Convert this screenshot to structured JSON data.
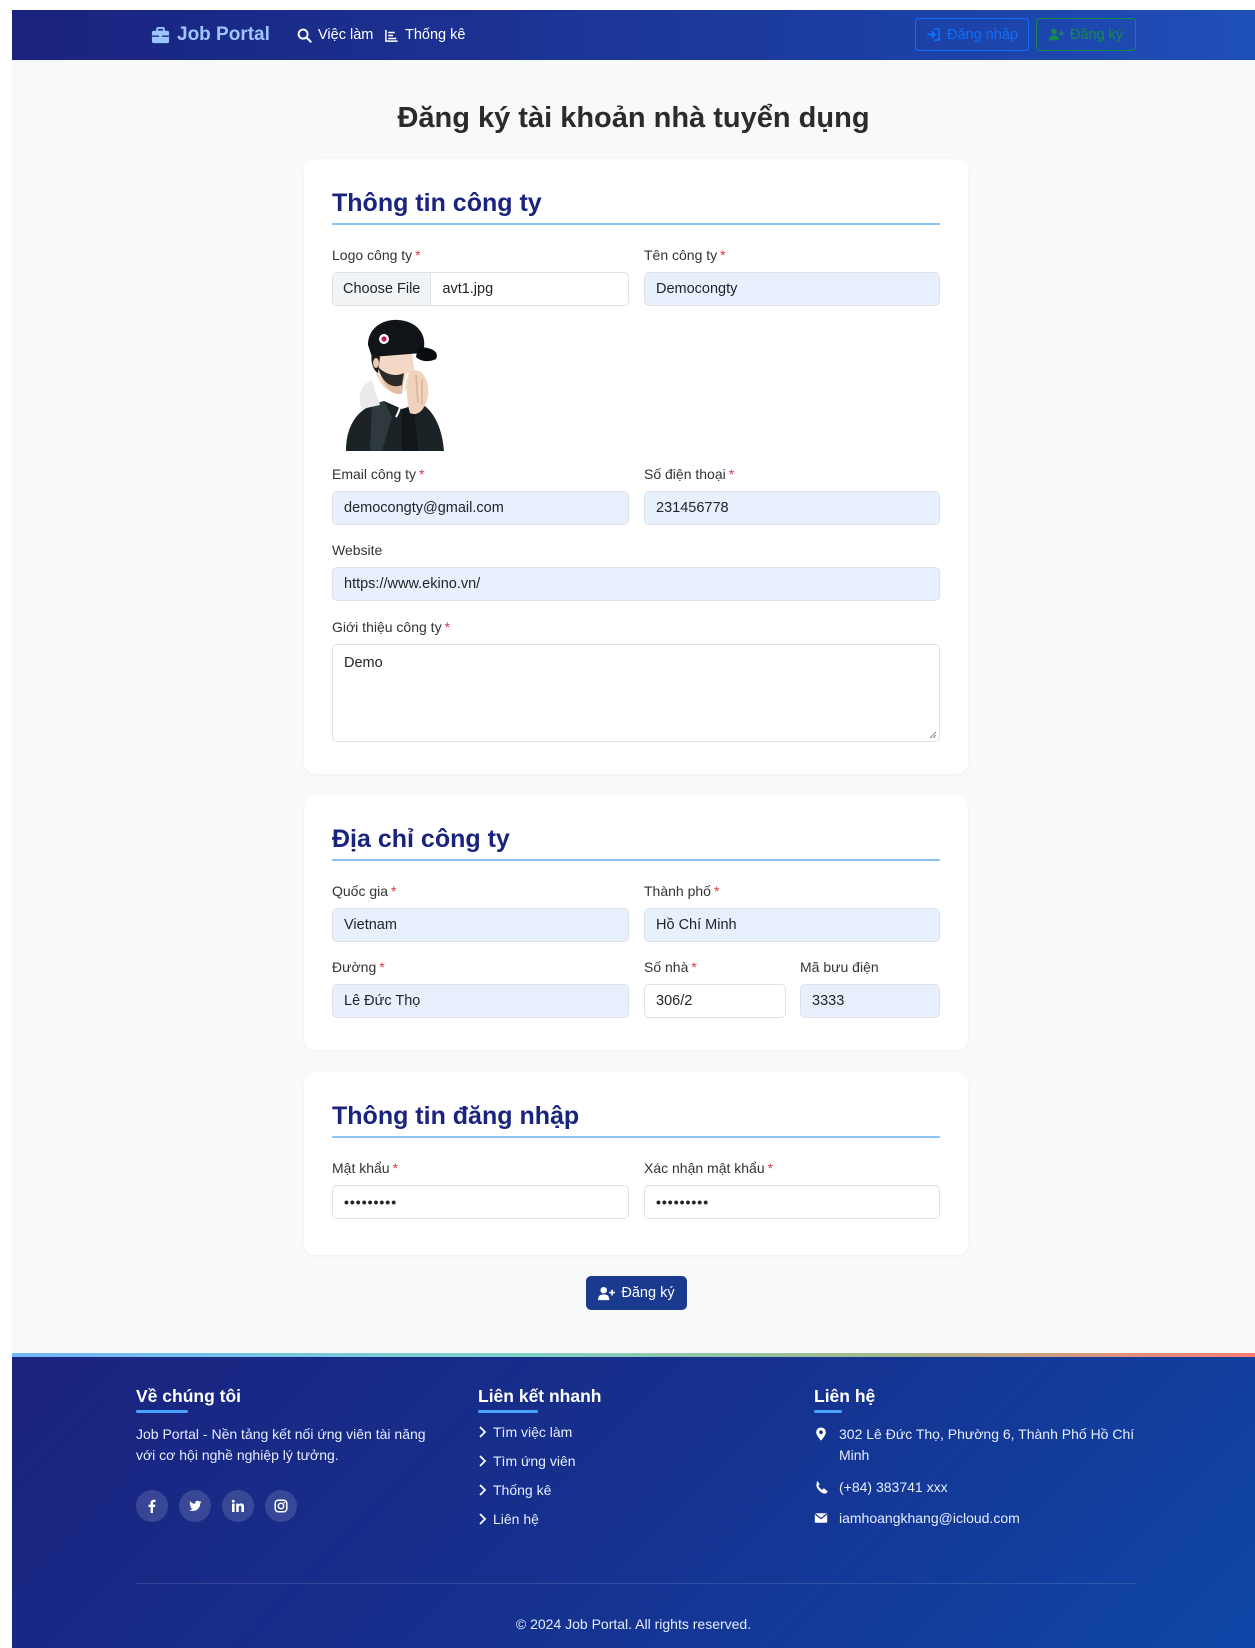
{
  "nav": {
    "brand": "Job Portal",
    "links": [
      {
        "label": "Việc làm"
      },
      {
        "label": "Thống kê"
      }
    ],
    "login": "Đăng nhập",
    "register": "Đăng ký"
  },
  "page": {
    "title": "Đăng ký tài khoản nhà tuyển dụng"
  },
  "company_info": {
    "title": "Thông tin công ty",
    "logo_label": "Logo công ty",
    "file_button": "Choose File",
    "file_name": "avt1.jpg",
    "name_label": "Tên công ty",
    "name_value": "Democongty",
    "email_label": "Email công ty",
    "email_value": "democongty@gmail.com",
    "phone_label": "Số điện thoại",
    "phone_value": "231456778",
    "website_label": "Website",
    "website_value": "https://www.ekino.vn/",
    "intro_label": "Giới thiệu công ty",
    "intro_value": "Demo"
  },
  "address": {
    "title": "Địa chỉ công ty",
    "country_label": "Quốc gia",
    "country_value": "Vietnam",
    "city_label": "Thành phố",
    "city_value": "Hồ Chí Minh",
    "street_label": "Đường",
    "street_value": "Lê Đức Thọ",
    "house_label": "Số nhà",
    "house_value": "306/2",
    "postal_label": "Mã bưu điện",
    "postal_value": "3333"
  },
  "login_info": {
    "title": "Thông tin đăng nhập",
    "password_label": "Mật khẩu",
    "password_value": "•••••••••",
    "confirm_label": "Xác nhận mật khẩu",
    "confirm_value": "•••••••••"
  },
  "required_mark": "*",
  "submit": "Đăng ký",
  "footer": {
    "about_title": "Về chúng tôi",
    "about_text_1": "Job Portal - Nền tảng kết nối ứng viên tài năng",
    "about_text_2": "với cơ hội nghề nghiệp lý tưởng.",
    "links_title": "Liên kết nhanh",
    "links": [
      "Tìm việc làm",
      "Tìm ứng viên",
      "Thống kê",
      "Liên hệ"
    ],
    "contact_title": "Liên hệ",
    "address_1": "302 Lê Đức Thọ, Phường 6, Thành Phố Hồ Chí",
    "address_2": "Minh",
    "phone": "(+84) 383741 xxx",
    "email": "iamhoangkhang@icloud.com",
    "copyright": "© 2024 Job Portal. All rights reserved."
  },
  "colors": {
    "nav_bg": "#1a237e",
    "accent": "#1a237e",
    "login_btn": "#0d6efd",
    "register_btn": "#198754",
    "required": "#dc3545"
  }
}
